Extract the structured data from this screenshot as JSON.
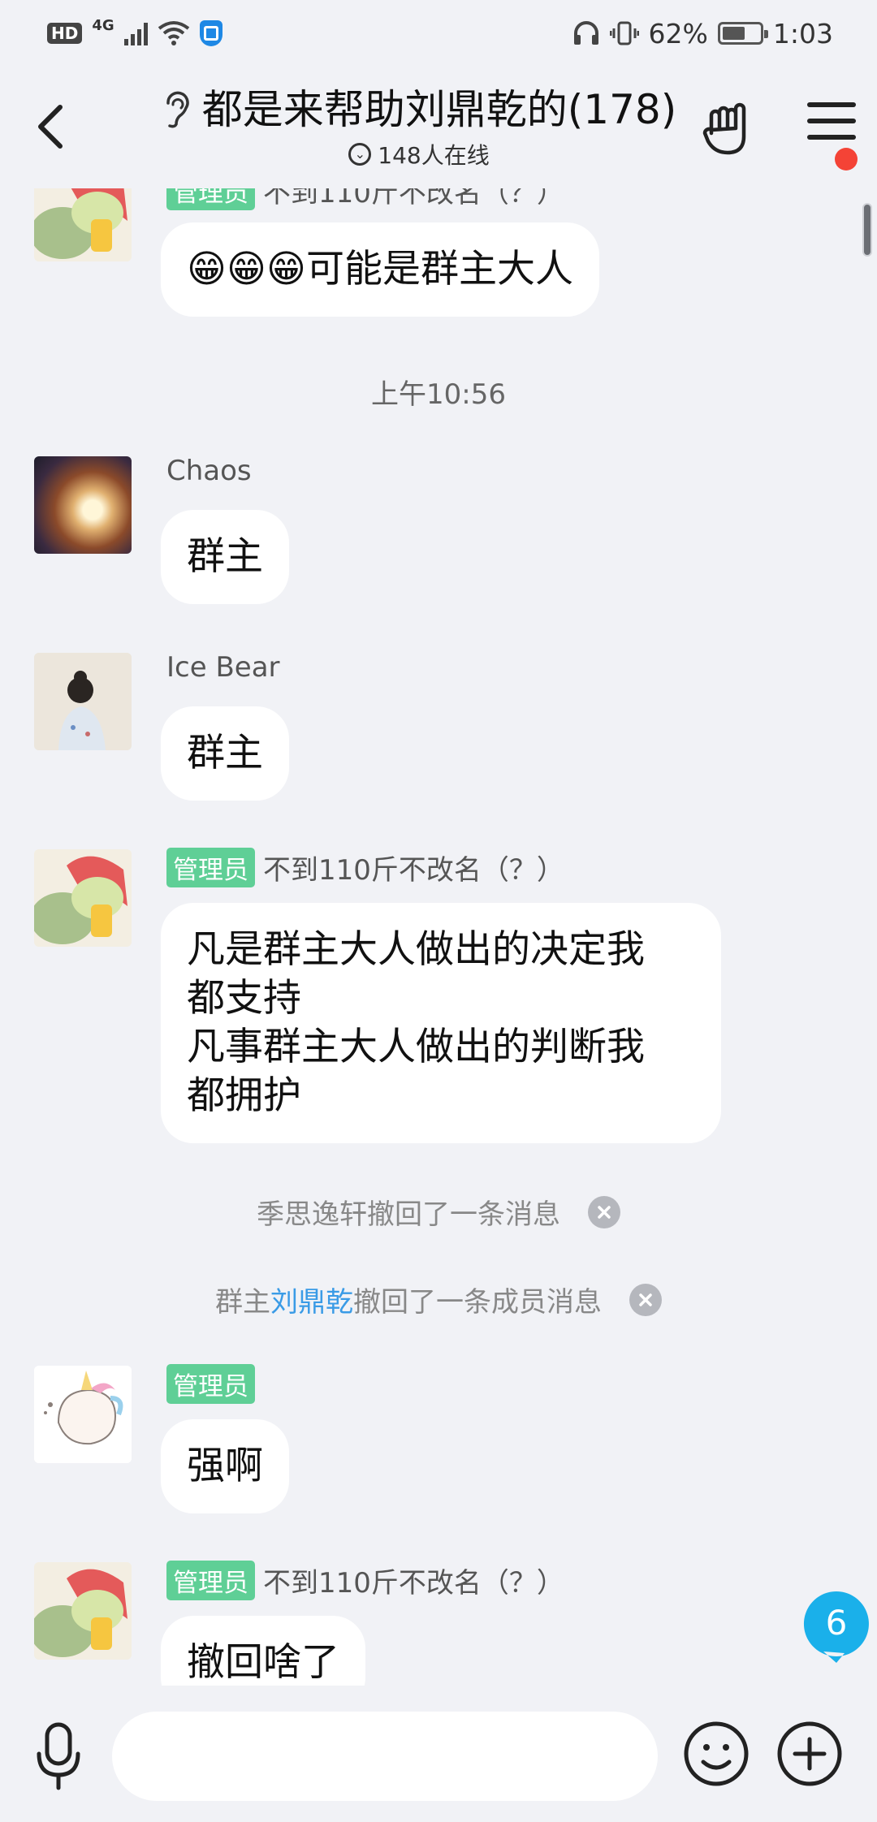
{
  "status_bar": {
    "hd": "HD",
    "network": "4G",
    "battery_percent": "62%",
    "battery_level": 0.62,
    "time": "1:03"
  },
  "header": {
    "title": "都是来帮助刘鼎乾的(178)",
    "online": "148人在线",
    "menu_has_notification": true
  },
  "messages": {
    "m0": {
      "sender_name": "不到110斤不改名（？）",
      "role_badge": "管理员",
      "text": "😁😁😁可能是群主大人"
    },
    "time_divider": "上午10:56",
    "m1": {
      "sender_name": "Chaos",
      "text": "群主"
    },
    "m2": {
      "sender_name": "Ice Bear",
      "text": "群主"
    },
    "m3": {
      "sender_name": "不到110斤不改名（？）",
      "role_badge": "管理员",
      "text": "凡是群主大人做出的决定我\n都支持\n凡事群主大人做出的判断我\n都拥护"
    },
    "notice1": {
      "text": "季思逸轩撤回了一条消息"
    },
    "notice2": {
      "prefix": "群主",
      "name": "刘鼎乾",
      "suffix": "撤回了一条成员消息"
    },
    "m4": {
      "role_badge": "管理员",
      "text": "强啊"
    },
    "m5": {
      "sender_name": "不到110斤不改名（？）",
      "role_badge": "管理员",
      "text": "撤回啥了"
    }
  },
  "unread_count": "6",
  "input": {
    "value": "",
    "placeholder": ""
  },
  "colors": {
    "background": "#f1f2f6",
    "admin_badge": "#5fcf96",
    "unread_badge": "#1ab0ea",
    "notification_dot": "#f44336",
    "link": "#3a9be6"
  }
}
